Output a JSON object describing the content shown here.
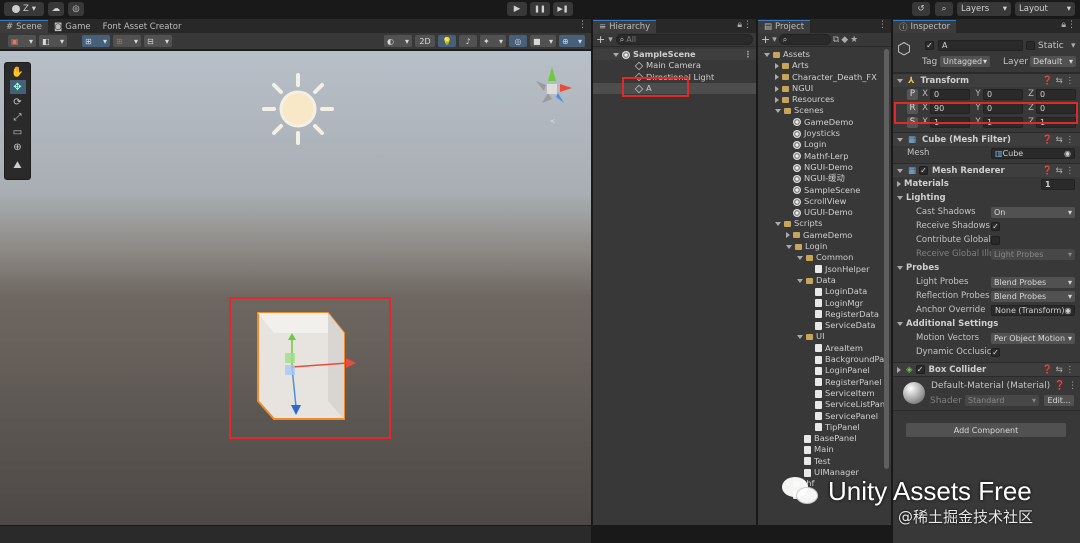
{
  "toolbar": {
    "account": "Z",
    "play": "▶",
    "pause": "❚❚",
    "step": "▶❚",
    "layers": "Layers",
    "layout": "Layout"
  },
  "scene_tabs": [
    "Scene",
    "Game",
    "Font Asset Creator"
  ],
  "scene_toolbar": {
    "mode_2d": "2D"
  },
  "hierarchy": {
    "title": "Hierarchy",
    "search_placeholder": "All",
    "root": "SampleScene",
    "items": [
      "Main Camera",
      "Directional Light",
      "A"
    ]
  },
  "project": {
    "title": "Project",
    "tree": [
      {
        "d": 0,
        "t": "Assets",
        "k": "folder",
        "o": true
      },
      {
        "d": 1,
        "t": "Arts",
        "k": "folder"
      },
      {
        "d": 1,
        "t": "Character_Death_FX",
        "k": "folder"
      },
      {
        "d": 1,
        "t": "NGUI",
        "k": "folder"
      },
      {
        "d": 1,
        "t": "Resources",
        "k": "folder"
      },
      {
        "d": 1,
        "t": "Scenes",
        "k": "folder",
        "o": true
      },
      {
        "d": 2,
        "t": "GameDemo",
        "k": "scene"
      },
      {
        "d": 2,
        "t": "Joysticks",
        "k": "scene"
      },
      {
        "d": 2,
        "t": "Login",
        "k": "scene"
      },
      {
        "d": 2,
        "t": "Mathf-Lerp",
        "k": "scene"
      },
      {
        "d": 2,
        "t": "NGUI-Demo",
        "k": "scene"
      },
      {
        "d": 2,
        "t": "NGUI-缓动",
        "k": "scene"
      },
      {
        "d": 2,
        "t": "SampleScene",
        "k": "scene"
      },
      {
        "d": 2,
        "t": "ScrollView",
        "k": "scene"
      },
      {
        "d": 2,
        "t": "UGUI-Demo",
        "k": "scene"
      },
      {
        "d": 1,
        "t": "Scripts",
        "k": "folder",
        "o": true
      },
      {
        "d": 2,
        "t": "GameDemo",
        "k": "folder"
      },
      {
        "d": 2,
        "t": "Login",
        "k": "folder",
        "o": true
      },
      {
        "d": 3,
        "t": "Common",
        "k": "folder",
        "o": true
      },
      {
        "d": 4,
        "t": "JsonHelper",
        "k": "script"
      },
      {
        "d": 3,
        "t": "Data",
        "k": "folder",
        "o": true
      },
      {
        "d": 4,
        "t": "LoginData",
        "k": "script"
      },
      {
        "d": 4,
        "t": "LoginMgr",
        "k": "script"
      },
      {
        "d": 4,
        "t": "RegisterData",
        "k": "script"
      },
      {
        "d": 4,
        "t": "ServiceData",
        "k": "script"
      },
      {
        "d": 3,
        "t": "UI",
        "k": "folder",
        "o": true
      },
      {
        "d": 4,
        "t": "AreaItem",
        "k": "script"
      },
      {
        "d": 4,
        "t": "BackgroundPa",
        "k": "script"
      },
      {
        "d": 4,
        "t": "LoginPanel",
        "k": "script"
      },
      {
        "d": 4,
        "t": "RegisterPanel",
        "k": "script"
      },
      {
        "d": 4,
        "t": "ServiceItem",
        "k": "script"
      },
      {
        "d": 4,
        "t": "ServiceListPan",
        "k": "script"
      },
      {
        "d": 4,
        "t": "ServicePanel",
        "k": "script"
      },
      {
        "d": 4,
        "t": "TipPanel",
        "k": "script"
      },
      {
        "d": 3,
        "t": "BasePanel",
        "k": "script"
      },
      {
        "d": 3,
        "t": "Main",
        "k": "script"
      },
      {
        "d": 3,
        "t": "Test",
        "k": "script"
      },
      {
        "d": 3,
        "t": "UIManager",
        "k": "script"
      },
      {
        "d": 2,
        "t": "thf",
        "k": "folder"
      },
      {
        "d": 2,
        "t": "on1",
        "k": "script"
      }
    ]
  },
  "inspector": {
    "title": "Inspector",
    "object_name": "A",
    "static_label": "Static",
    "tag_label": "Tag",
    "tag_value": "Untagged",
    "layer_label": "Layer",
    "layer_value": "Default",
    "transform": {
      "title": "Transform",
      "position": {
        "axis": "P",
        "x": "0",
        "y": "0",
        "z": "0"
      },
      "rotation": {
        "axis": "R",
        "x": "90",
        "y": "0",
        "z": "0"
      },
      "scale": {
        "axis": "S",
        "x": "1",
        "y": "1",
        "z": "1"
      }
    },
    "mesh_filter": {
      "title": "Cube (Mesh Filter)",
      "mesh_label": "Mesh",
      "mesh_value": "Cube"
    },
    "mesh_renderer": {
      "title": "Mesh Renderer",
      "materials_label": "Materials",
      "materials_count": "1",
      "lighting_label": "Lighting",
      "cast_shadows_label": "Cast Shadows",
      "cast_shadows_value": "On",
      "receive_shadows_label": "Receive Shadows",
      "contribute_gi_label": "Contribute Global",
      "receive_gi_label": "Receive Global Illu",
      "receive_gi_value": "Light Probes",
      "probes_label": "Probes",
      "light_probes_label": "Light Probes",
      "light_probes_value": "Blend Probes",
      "reflection_probes_label": "Reflection Probes",
      "reflection_probes_value": "Blend Probes",
      "anchor_override_label": "Anchor Override",
      "anchor_override_value": "None (Transform)",
      "additional_label": "Additional Settings",
      "motion_vectors_label": "Motion Vectors",
      "motion_vectors_value": "Per Object Motion",
      "dynamic_occlusion_label": "Dynamic Occlusic"
    },
    "box_collider": {
      "title": "Box Collider"
    },
    "material": {
      "name": "Default-Material (Material)",
      "shader_label": "Shader",
      "shader_value": "Standard",
      "edit_label": "Edit..."
    },
    "add_component": "Add Component"
  },
  "watermark": {
    "main": "Unity Assets Free",
    "sub": "@稀土掘金技术社区"
  },
  "colors": {
    "highlight": "#e02a2a",
    "selection": "#2c5d87",
    "accent": "#3a79bb"
  }
}
